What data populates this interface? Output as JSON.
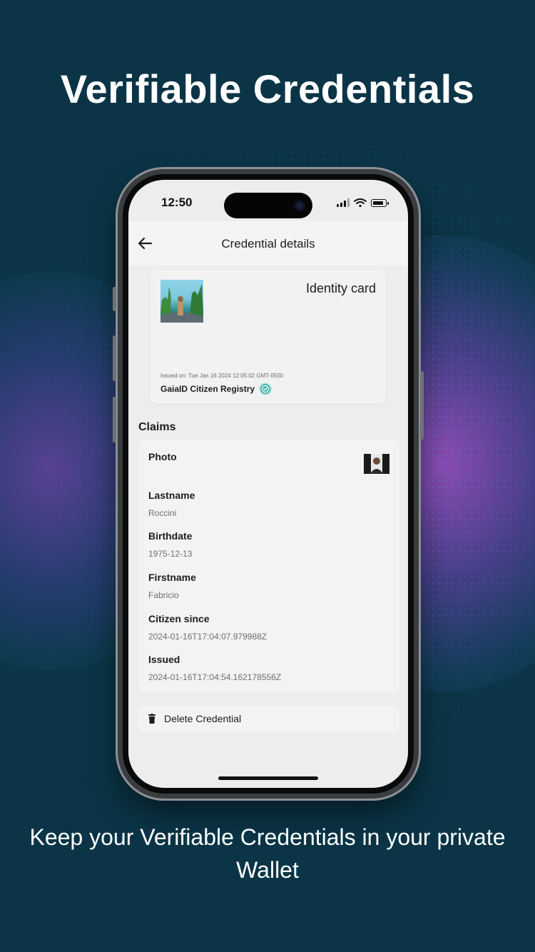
{
  "headline": "Verifiable Credentials",
  "caption": "Keep your Verifiable Credentials in your private Wallet",
  "status_bar": {
    "time": "12:50"
  },
  "header": {
    "title": "Credential details",
    "back_icon": "arrow-left-icon"
  },
  "credential_card": {
    "type": "Identity card",
    "issued_on": "Issued on: Tue Jan 16 2024 12:05:02 GMT-0500",
    "issuer": "GaiaID Citizen Registry",
    "verified_icon": "verified-check-icon",
    "verified_color": "#3fb8a8"
  },
  "claims": {
    "title": "Claims",
    "items": [
      {
        "label": "Photo",
        "value": ""
      },
      {
        "label": "Lastname",
        "value": "Roccini"
      },
      {
        "label": "Birthdate",
        "value": "1975-12-13"
      },
      {
        "label": "Firstname",
        "value": "Fabricio"
      },
      {
        "label": "Citizen since",
        "value": "2024-01-16T17:04:07.979988Z"
      },
      {
        "label": "Issued",
        "value": "2024-01-16T17:04:54.162178556Z"
      }
    ]
  },
  "actions": {
    "delete_label": "Delete Credential",
    "delete_icon": "trash-icon"
  },
  "colors": {
    "background": "#0b3547",
    "accent_teal": "#3fb8a8",
    "screen_bg": "#ebedef"
  }
}
